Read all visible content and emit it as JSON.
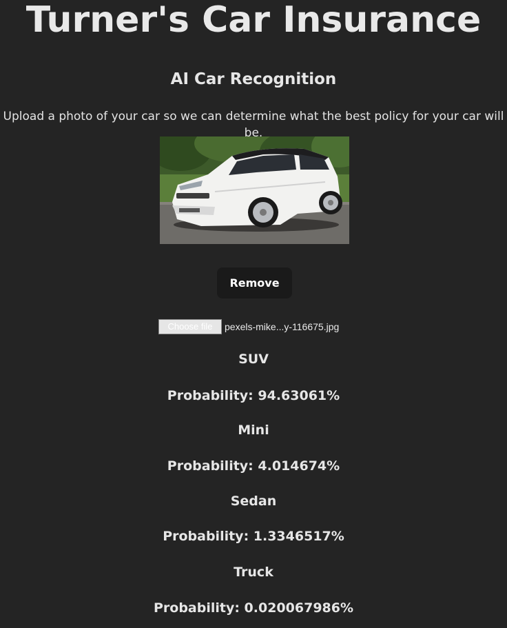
{
  "header": {
    "title": "Turner's Car Insurance",
    "subtitle": "AI Car Recognition",
    "description": "Upload a photo of your car so we can determine what the best policy for your car will be."
  },
  "upload": {
    "photo_alt": "uploaded car photo",
    "remove_label": "Remove",
    "choose_file_label": "Choose file",
    "file_name": "pexels-mike...y-116675.jpg"
  },
  "results": [
    {
      "label": "SUV",
      "probability": "Probability: 94.63061%"
    },
    {
      "label": "Mini",
      "probability": "Probability: 4.014674%"
    },
    {
      "label": "Sedan",
      "probability": "Probability: 1.3346517%"
    },
    {
      "label": "Truck",
      "probability": "Probability: 0.020067986%"
    }
  ],
  "colors": {
    "background": "#242424",
    "text": "#e6e6e6",
    "button": "#1a1a1a"
  }
}
